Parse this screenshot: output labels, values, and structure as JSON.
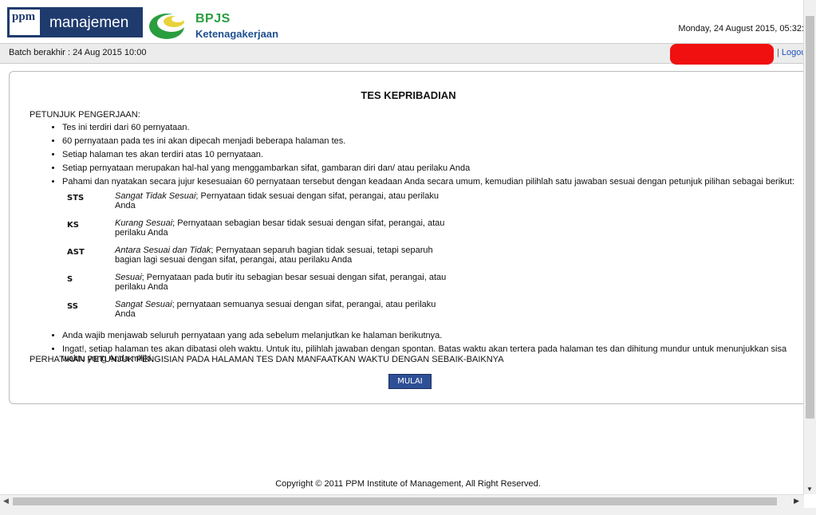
{
  "header": {
    "ppm_logo_letters": "ppm",
    "ppm_logo_text": "manajemen",
    "bpjs_title": "BPJS",
    "bpjs_subtitle": "Ketenagakerjaan",
    "datetime": "Monday, 24 August 2015, 05:32:"
  },
  "subbar": {
    "batch": "Batch berakhir : 24 Aug 2015 10:00",
    "separator": "|",
    "logout": "Logou"
  },
  "page": {
    "title": "TES KEPRIBADIAN",
    "instructions_heading": "PETUNJUK PENGERJAAN:",
    "bullets": [
      "Tes ini terdiri dari 60 pernyataan.",
      "60 pernyataan pada tes ini akan dipecah menjadi beberapa halaman tes.",
      "Setiap halaman tes akan terdiri atas 10 pernyataan.",
      "Setiap pernyataan merupakan hal-hal yang menggambarkan sifat, gambaran diri dan/ atau perilaku Anda",
      "Pahami dan nyatakan secara jujur kesesuaian 60 pernyataan tersebut dengan keadaan Anda secara umum, kemudian pilihlah satu jawaban sesuai dengan petunjuk pilihan sebagai berikut:"
    ],
    "legend": [
      {
        "code": "STS",
        "term": "Sangat Tidak Sesuai",
        "desc": "; Pernyataan tidak sesuai dengan sifat, perangai, atau perilaku Anda"
      },
      {
        "code": "KS",
        "term": "Kurang Sesuai",
        "desc": "; Pernyataan sebagian besar tidak sesuai dengan sifat, perangai, atau perilaku Anda"
      },
      {
        "code": "AST",
        "term": "Antara Sesuai dan Tidak",
        "desc": "; Pernyataan separuh bagian tidak sesuai, tetapi separuh bagian lagi sesuai dengan sifat, perangai, atau perilaku Anda"
      },
      {
        "code": "S",
        "term": "Sesuai",
        "desc": "; Pernyataan pada butir itu sebagian besar sesuai dengan sifat, perangai, atau perilaku Anda"
      },
      {
        "code": "SS",
        "term": "Sangat Sesuai",
        "desc": "; pernyataan semuanya sesuai dengan sifat, perangai, atau perilaku Anda"
      }
    ],
    "bullets_after": [
      "Anda wajib menjawab seluruh pernyataan yang ada sebelum melanjutkan ke halaman berikutnya.",
      "Ingat!, setiap halaman tes akan dibatasi oleh waktu. Untuk itu, pilihlah jawaban dengan spontan. Batas waktu akan tertera pada halaman tes dan dihitung mundur untuk menunjukkan sisa waktu yang Anda miliki."
    ],
    "closing_note": "PERHATIKAN PETUNJUK PENGISIAN PADA HALAMAN TES DAN MANFAATKAN WAKTU DENGAN SEBAIK-BAIKNYA",
    "start_button": "MULAI"
  },
  "footer": {
    "copyright": "Copyright © 2011 PPM Institute of Management, All Right Reserved."
  },
  "colors": {
    "ppm_blue": "#1f3b6e",
    "bpjs_green": "#2a9d3f",
    "button_blue": "#2e4f96",
    "redaction_red": "#f01010"
  },
  "icons": {
    "scroll_down": "▼",
    "scroll_left": "◀",
    "scroll_right": "▶"
  }
}
